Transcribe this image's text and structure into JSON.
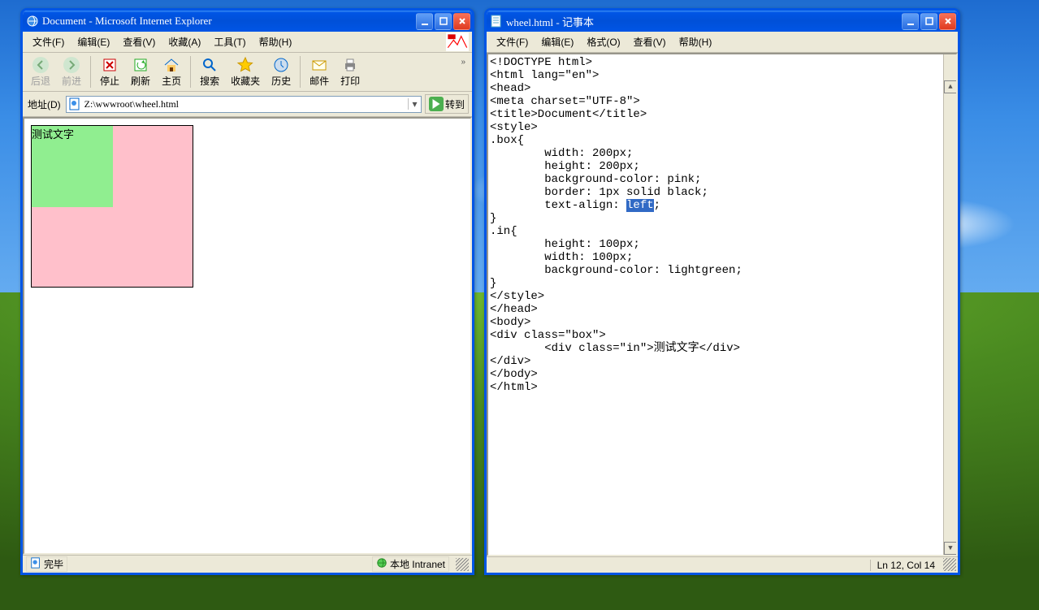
{
  "ie": {
    "title": "Document - Microsoft Internet Explorer",
    "menus": {
      "file": "文件(F)",
      "edit": "编辑(E)",
      "view": "查看(V)",
      "fav": "收藏(A)",
      "tools": "工具(T)",
      "help": "帮助(H)"
    },
    "toolbar": {
      "back": "后退",
      "forward": "前进",
      "stop": "停止",
      "refresh": "刷新",
      "home": "主页",
      "search": "搜索",
      "favorites": "收藏夹",
      "history": "历史",
      "mail": "邮件",
      "print": "打印"
    },
    "address_label": "地址(D)",
    "address_value": "Z:\\wwwroot\\wheel.html",
    "go_label": "转到",
    "rendered_text": "测试文字",
    "status_done": "完毕",
    "status_zone": "本地 Intranet"
  },
  "notepad": {
    "title": "wheel.html - 记事本",
    "menus": {
      "file": "文件(F)",
      "edit": "编辑(E)",
      "format": "格式(O)",
      "view": "查看(V)",
      "help": "帮助(H)"
    },
    "code_pre": "<!DOCTYPE html>\n<html lang=\"en\">\n<head>\n<meta charset=\"UTF-8\">\n<title>Document</title>\n<style>\n.box{\n        width: 200px;\n        height: 200px;\n        background-color: pink;\n        border: 1px solid black;\n        text-align: ",
    "code_sel": "left",
    "code_post": ";\n}\n.in{\n        height: 100px;\n        width: 100px;\n        background-color: lightgreen;\n}\n</style>\n</head>\n<body>\n<div class=\"box\">\n        <div class=\"in\">测试文字</div>\n</div>\n</body>\n</html>",
    "status": "Ln 12, Col 14"
  }
}
